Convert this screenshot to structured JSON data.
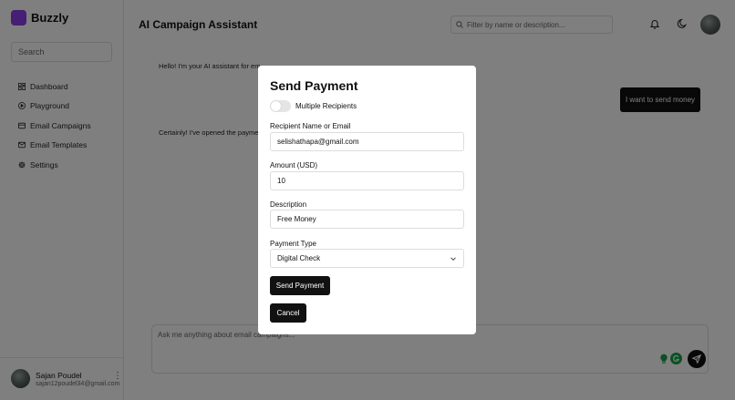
{
  "sidebar": {
    "brand": "Buzzly",
    "search_placeholder": "Search",
    "items": [
      {
        "label": "Dashboard",
        "icon": "grid-icon"
      },
      {
        "label": "Playground",
        "icon": "play-circle-icon"
      },
      {
        "label": "Email Campaigns",
        "icon": "card-icon"
      },
      {
        "label": "Email Templates",
        "icon": "mail-icon"
      },
      {
        "label": "Settings",
        "icon": "gear-icon"
      }
    ],
    "user": {
      "name": "Sajan Poudel",
      "email": "sajan12poudel34@gmail.com"
    }
  },
  "header": {
    "title": "AI Campaign Assistant",
    "search_placeholder": "Filter by name or description..."
  },
  "chat": {
    "bot_message_1": "Hello! I'm your AI assistant for em",
    "bot_message_2": "Certainly! I've opened the payme",
    "user_message": "I want to send money",
    "input_placeholder": "Ask me anything about email campaigns..."
  },
  "modal": {
    "title": "Send Payment",
    "toggle_label": "Multiple Recipients",
    "toggle_on": false,
    "recipient_label": "Recipient Name or Email",
    "recipient_value": "selishathapa@gmail.com",
    "amount_label": "Amount (USD)",
    "amount_value": "10",
    "description_label": "Description",
    "description_value": "Free Money",
    "payment_type_label": "Payment Type",
    "payment_type_value": "Digital Check",
    "submit_label": "Send Payment",
    "cancel_label": "Cancel"
  },
  "colors": {
    "brand": "#8b3fe6",
    "primary": "#111111",
    "overlay": "rgba(0,0,0,0.5)",
    "grammar_badge": "#16a34a"
  }
}
